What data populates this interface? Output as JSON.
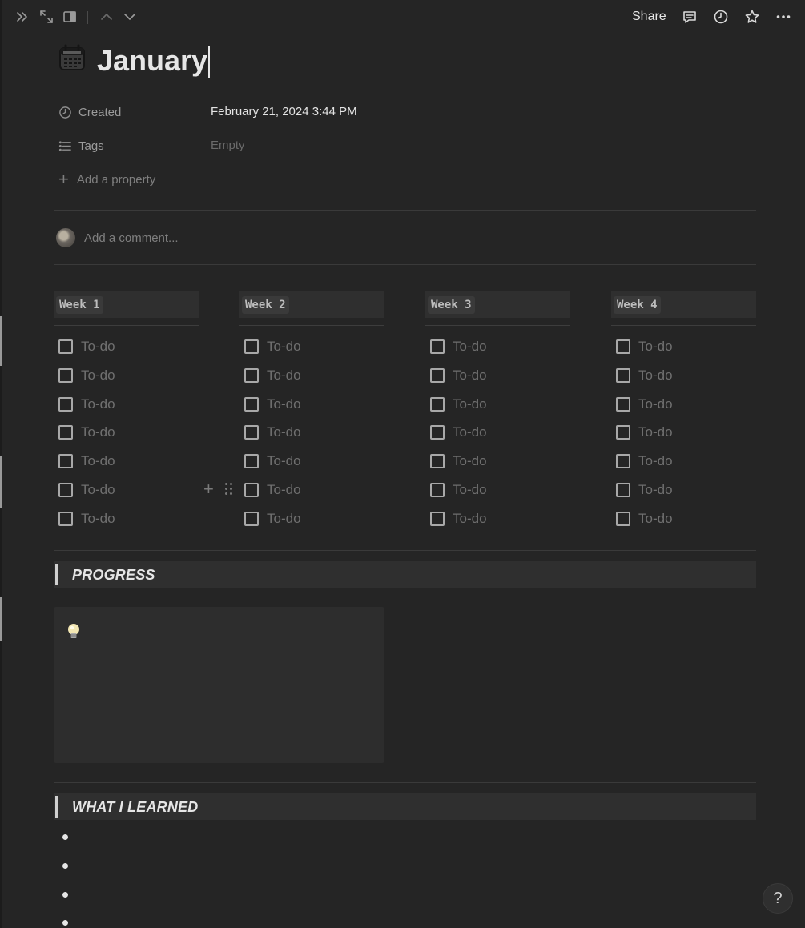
{
  "topbar": {
    "share_label": "Share"
  },
  "page": {
    "title": "January",
    "title_icon": "calendar-icon"
  },
  "properties": [
    {
      "icon": "clock-icon",
      "label": "Created",
      "value": "February 21, 2024 3:44 PM",
      "empty": false
    },
    {
      "icon": "list-icon",
      "label": "Tags",
      "value": "Empty",
      "empty": true
    }
  ],
  "add_property_label": "Add a property",
  "comment": {
    "placeholder": "Add a comment..."
  },
  "weeks": [
    {
      "label": "Week 1",
      "todos": [
        "To-do",
        "To-do",
        "To-do",
        "To-do",
        "To-do",
        "To-do",
        "To-do"
      ]
    },
    {
      "label": "Week 2",
      "todos": [
        "To-do",
        "To-do",
        "To-do",
        "To-do",
        "To-do",
        "To-do",
        "To-do"
      ]
    },
    {
      "label": "Week 3",
      "todos": [
        "To-do",
        "To-do",
        "To-do",
        "To-do",
        "To-do",
        "To-do",
        "To-do"
      ]
    },
    {
      "label": "Week 4",
      "todos": [
        "To-do",
        "To-do",
        "To-do",
        "To-do",
        "To-do",
        "To-do",
        "To-do"
      ]
    }
  ],
  "sections": {
    "progress": "PROGRESS",
    "learned": "WHAT I LEARNED"
  },
  "callout_icon": "lightbulb-icon",
  "help_label": "?",
  "colors": {
    "background": "#252525",
    "text": "#e6e6e6",
    "muted": "#6f6f6f",
    "block_bg": "#2f2f2f"
  }
}
